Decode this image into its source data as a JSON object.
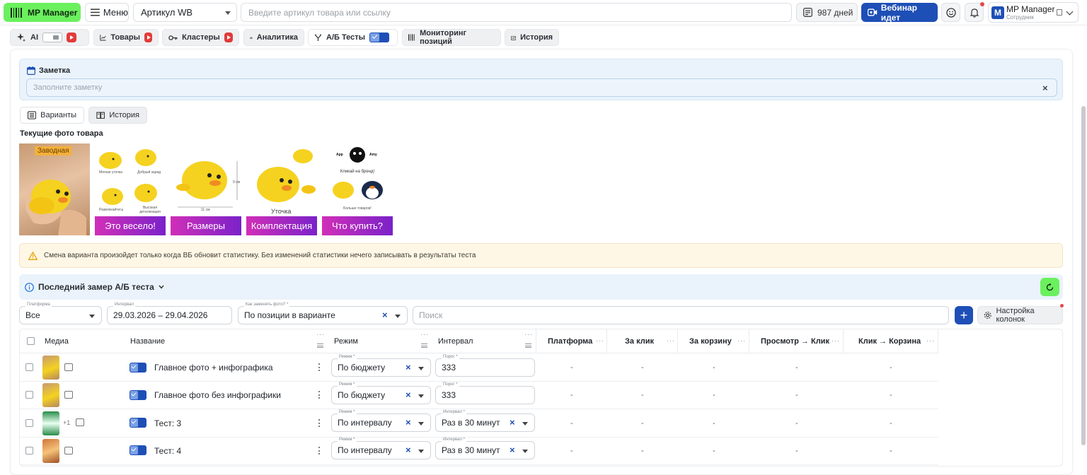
{
  "header": {
    "logo_label": "MP Manager",
    "menu_label": "Меню",
    "article_select": "Артикул WB",
    "search_placeholder": "Введите артикул товара или ссылку",
    "days_label": "987 дней",
    "webinar_label": "Вебинар идет",
    "account_name": "MP Manager",
    "account_role": "Сотрудник",
    "account_initial": "M"
  },
  "nav": {
    "tabs": [
      {
        "label": "AI"
      },
      {
        "label": "Товары"
      },
      {
        "label": "Кластеры"
      },
      {
        "label": "Аналитика"
      },
      {
        "label": "А/Б Тесты"
      },
      {
        "label": "Мониторинг позиций"
      },
      {
        "label": "История"
      }
    ]
  },
  "note": {
    "title": "Заметка",
    "placeholder": "Заполните заметку",
    "clear": "×"
  },
  "view_buttons": {
    "variants": "Варианты",
    "history": "История"
  },
  "photos": {
    "title": "Текущие фото товара",
    "items": [
      {
        "badge": "Заводная",
        "banner": ""
      },
      {
        "captions": [
          "Мягкая уточка",
          "Добрый заряд",
          "Развлекайтесь",
          "Высокая детализация"
        ],
        "banner": "Это весело!"
      },
      {
        "captions": [
          "11 см",
          "9 см"
        ],
        "banner": "Размеры"
      },
      {
        "captions": [
          "Уточка"
        ],
        "banner": "Комплектация"
      },
      {
        "captions": [
          "App",
          "Amy",
          "Кликай на бренд!",
          "Больше товаров!"
        ],
        "banner": "Что купить?"
      }
    ]
  },
  "warning": "Смена варианта произойдет только когда ВБ обновит статистику. Без изменений статистики нечего записывать в результаты теста",
  "measure": {
    "label": "Последний замер А/Б теста"
  },
  "filters": {
    "platform": {
      "label": "Платформа",
      "value": "Все"
    },
    "interval": {
      "label": "Интервал",
      "value": "29.03.2026 – 29.04.2026"
    },
    "replace": {
      "label": "Как заменять фото? *",
      "value": "По позиции в варианте"
    },
    "search_placeholder": "Поиск",
    "add": "+",
    "columns_btn": "Настройка колонок"
  },
  "table": {
    "headers": {
      "media": "Медиа",
      "name": "Название",
      "mode": "Режим",
      "interval": "Интервал",
      "platform": "Платформа",
      "per_click": "За клик",
      "per_cart": "За корзину",
      "view_click": "Просмотр → Клик",
      "click_cart": "Клик → Корзина"
    },
    "rows": [
      {
        "name": "Главное фото + инфографика",
        "extra": "",
        "mode_label": "Режим *",
        "mode": "По бюджету",
        "int_label": "Порог *",
        "interval": "333",
        "platform": "-",
        "per_click": "-",
        "per_cart": "-",
        "view_click": "-",
        "click_cart": "-"
      },
      {
        "name": "Главное фото без инфографики",
        "extra": "",
        "mode_label": "Режим *",
        "mode": "По бюджету",
        "int_label": "Порог *",
        "interval": "333",
        "platform": "-",
        "per_click": "-",
        "per_cart": "-",
        "view_click": "-",
        "click_cart": "-"
      },
      {
        "name": "Тест: 3",
        "extra": "+1",
        "mode_label": "Режим *",
        "mode": "По интервалу",
        "int_label": "Интервал *",
        "interval": "Раз в 30 минут",
        "platform": "-",
        "per_click": "-",
        "per_cart": "-",
        "view_click": "-",
        "click_cart": "-"
      },
      {
        "name": "Тест: 4",
        "extra": "",
        "mode_label": "Режим *",
        "mode": "По интервалу",
        "int_label": "Интервал *",
        "interval": "Раз в 30 минут",
        "platform": "-",
        "per_click": "-",
        "per_cart": "-",
        "view_click": "-",
        "click_cart": "-"
      }
    ]
  },
  "colors": {
    "accent_green": "#6bf05e",
    "accent_blue": "#1e4fb6",
    "banner_pink": "#d12fb8",
    "warning_bg": "#fff7e6"
  }
}
